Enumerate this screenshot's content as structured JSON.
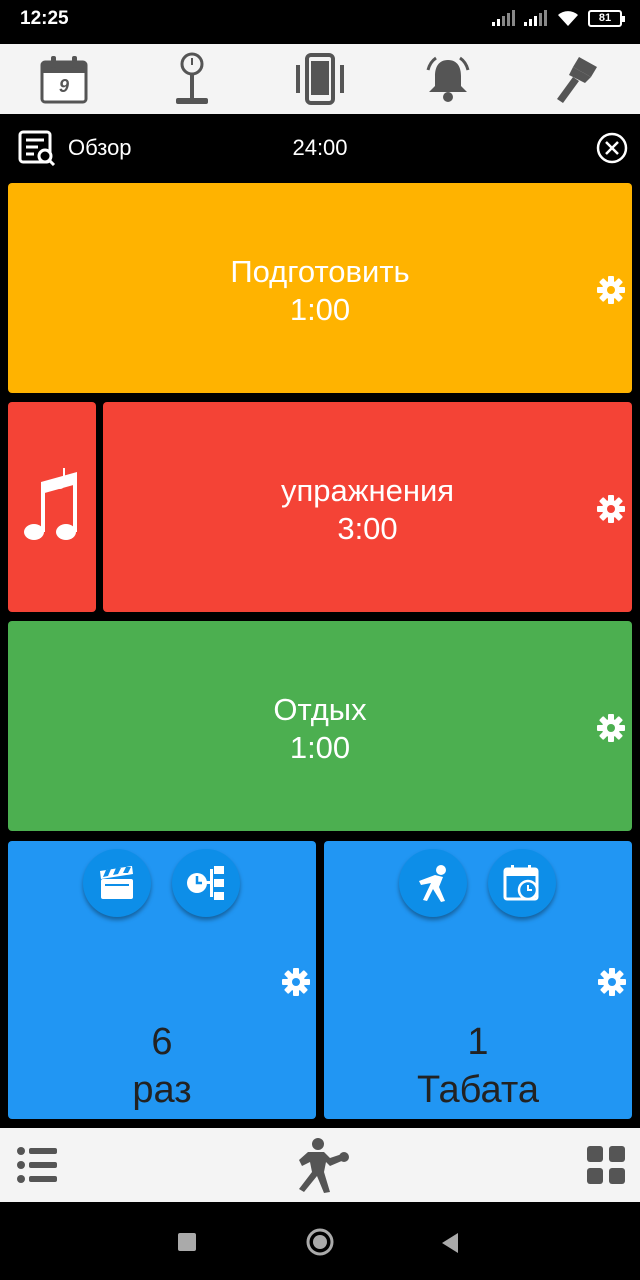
{
  "status_bar": {
    "time": "12:25",
    "battery": "81",
    "icons": [
      "signal-icon",
      "signal-icon",
      "wifi-icon",
      "battery-icon"
    ]
  },
  "toolbar": {
    "calendar_day": "9",
    "icons": [
      "calendar-icon",
      "scale-icon",
      "phone-vibrate-icon",
      "bell-icon",
      "brush-icon"
    ]
  },
  "overview": {
    "label": "Обзор",
    "total_time": "24:00"
  },
  "tiles": {
    "prepare": {
      "title": "Подготовить",
      "time": "1:00",
      "color": "#ffb300"
    },
    "work": {
      "title": "упражнения",
      "time": "3:00",
      "color": "#f44336"
    },
    "rest": {
      "title": "Отдых",
      "time": "1:00",
      "color": "#4caf50"
    },
    "cycles": {
      "count": "6",
      "unit": "раз",
      "color": "#2196f3"
    },
    "tabata": {
      "count": "1",
      "unit": "Табата",
      "color": "#2196f3"
    }
  },
  "bottom_bar": {
    "icons": [
      "list-icon",
      "boxing-icon",
      "grid-icon"
    ]
  },
  "nav_bar": {
    "icons": [
      "recents-icon",
      "home-icon",
      "back-icon"
    ]
  }
}
